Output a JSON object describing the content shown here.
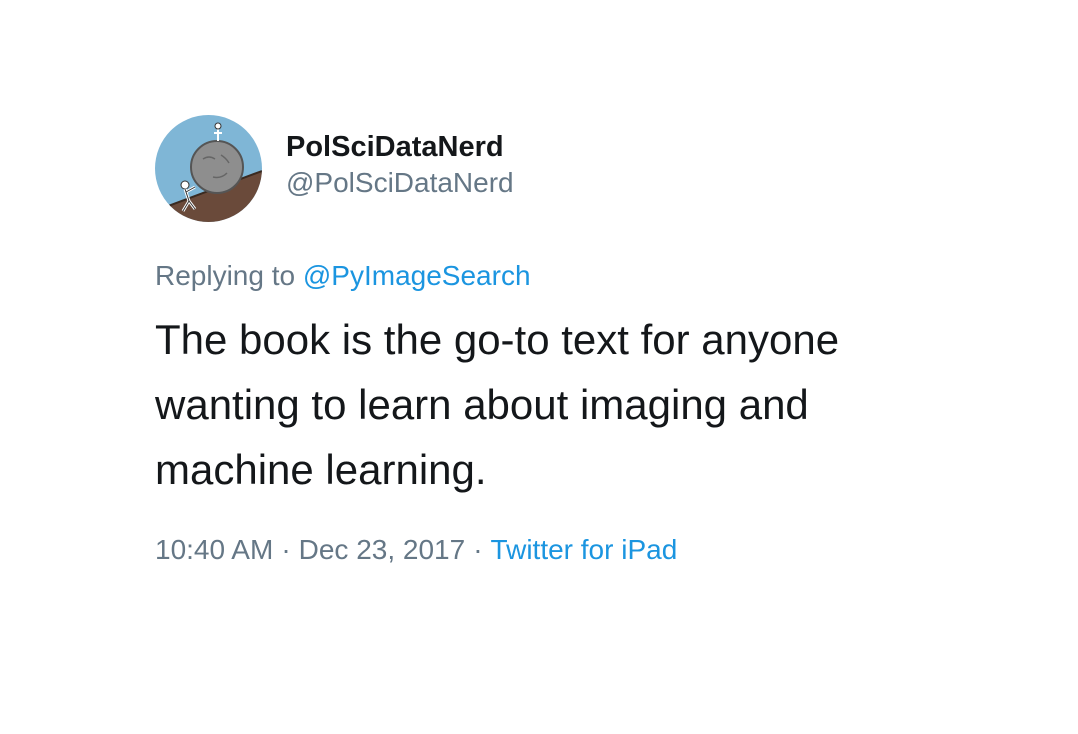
{
  "user": {
    "display_name": "PolSciDataNerd",
    "handle": "@PolSciDataNerd",
    "avatar_icon": "sisyphus-boulder-avatar"
  },
  "reply": {
    "prefix": "Replying to",
    "target": "@PyImageSearch"
  },
  "tweet": {
    "text": "The book is the go-to text for anyone wanting to learn about imaging and machine learning."
  },
  "meta": {
    "time": "10:40 AM",
    "separator": "·",
    "date": "Dec 23, 2017",
    "source": "Twitter for iPad"
  },
  "colors": {
    "text": "#14171a",
    "secondary": "#657786",
    "link": "#1b95e0",
    "avatar_bg": "#7fb6d6"
  }
}
